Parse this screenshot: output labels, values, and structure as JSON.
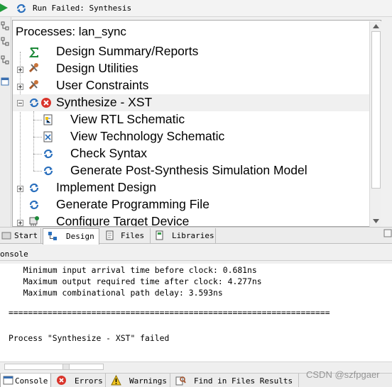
{
  "status_bar": {
    "text": "Run Failed: Synthesis"
  },
  "processes": {
    "title": "Processes: lan_sync",
    "items": [
      {
        "label": "Design Summary/Reports",
        "icon": "sigma-icon",
        "expander": "none"
      },
      {
        "label": "Design Utilities",
        "icon": "tools-icon",
        "expander": "plus"
      },
      {
        "label": "User Constraints",
        "icon": "tools-icon",
        "expander": "plus"
      },
      {
        "label": "Synthesize - XST",
        "icon": "run-failed-icon",
        "expander": "minus"
      },
      {
        "label": "View RTL Schematic",
        "icon": "schematic-icon"
      },
      {
        "label": "View Technology Schematic",
        "icon": "tech-schematic-icon"
      },
      {
        "label": "Check Syntax",
        "icon": "run-icon"
      },
      {
        "label": "Generate Post-Synthesis Simulation Model",
        "icon": "run-icon"
      },
      {
        "label": "Implement Design",
        "icon": "run-icon",
        "expander": "plus"
      },
      {
        "label": "Generate Programming File",
        "icon": "run-icon",
        "expander": "none"
      },
      {
        "label": "Configure Target Device",
        "icon": "device-icon",
        "expander": "plus"
      }
    ]
  },
  "tabs": [
    {
      "label": "Start",
      "active": false
    },
    {
      "label": "Design",
      "active": true
    },
    {
      "label": "Files",
      "active": false
    },
    {
      "label": "Libraries",
      "active": false
    }
  ],
  "console": {
    "title": "onsole",
    "lines": [
      "   Minimum input arrival time before clock: 0.681ns",
      "   Maximum output required time after clock: 4.277ns",
      "   Maximum combinational path delay: 3.593ns",
      "",
      "==================================================================",
      "",
      "",
      "Process \"Synthesize - XST\" failed"
    ]
  },
  "bottom_tabs": [
    {
      "label": "Console",
      "active": true
    },
    {
      "label": "Errors",
      "active": false
    },
    {
      "label": "Warnings",
      "active": false
    },
    {
      "label": "Find in Files Results",
      "active": false
    }
  ],
  "watermark": "CSDN @szfpgaer",
  "colors": {
    "run_blue": "#2a6fbd",
    "error_red": "#d9342b",
    "sigma_green": "#1e8a3a",
    "tools_brown": "#a85a2a",
    "warning_yellow": "#f3c623"
  }
}
